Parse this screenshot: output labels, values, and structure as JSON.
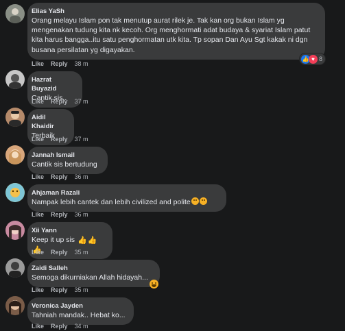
{
  "actions": {
    "like": "Like",
    "reply": "Reply"
  },
  "comments": [
    {
      "author": "Elias YaSh",
      "text": "Orang melayu Islam pon tak menutup aurat rilek je. Tak kan org bukan Islam yg mengenakan tudung kita nk kecoh. Org menghormati adat budaya & syariat Islam patut kita harus bangga..itu satu penghormatan utk kita. Tp sopan Dan Ayu Sgt kakak ni dgn busana persilatan yg digayakan.",
      "time": "38 m",
      "reaction_count": "8"
    },
    {
      "author": "Hazrat Buyazid",
      "text": "Cantik sis..",
      "time": "37 m"
    },
    {
      "author": "Aidil Khaidir",
      "text": "Terbaik",
      "time": "37 m"
    },
    {
      "author": "Jannah Ismail",
      "text": "Cantik sis bertudung",
      "time": "36 m"
    },
    {
      "author": "Ahjaman Razali",
      "text": "Nampak lebih cantek dan lebih civilized and polite",
      "time": "36 m"
    },
    {
      "author": "Xii Yann",
      "text": "Keep it up sis",
      "time": "35 m"
    },
    {
      "author": "Zaidi Salleh",
      "text": "Semoga dikurniakan Allah hidayah...",
      "time": "35 m"
    },
    {
      "author": "Veronica Jayden",
      "text": "Tahniah mandak.. Hebat ko...",
      "time": "34 m"
    }
  ],
  "avatar_colors": [
    "#8a8f86",
    "#c7c7c7",
    "#b58a6a",
    "#d9a77c",
    "#e0b04f",
    "#c88aa0",
    "#9a9a9a",
    "#7a5c48"
  ]
}
